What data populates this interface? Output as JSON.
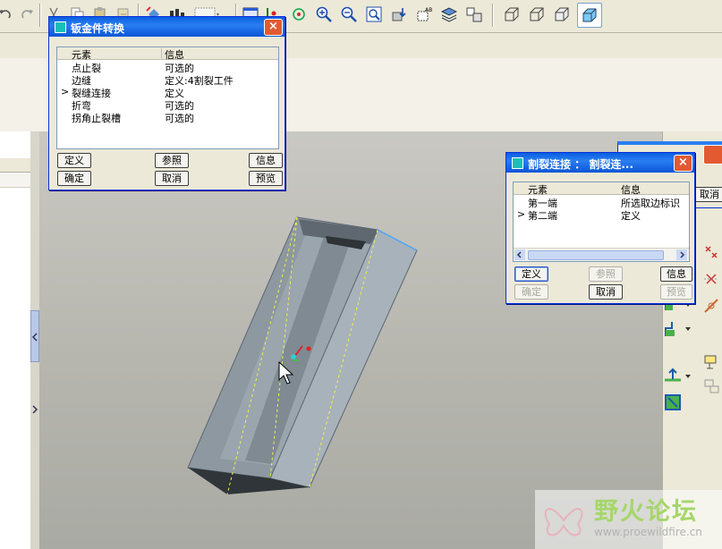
{
  "toolbar": {
    "icons": [
      "undo-icon",
      "redo-icon",
      "cut-icon",
      "copy-icon",
      "paste-icon",
      "paste-special-icon",
      "regenerate-icon",
      "dimension-icon",
      "sketch-box-icon",
      "repaint-icon",
      "spin-center-icon",
      "orient-icon",
      "zoom-in-icon",
      "zoom-out-icon",
      "refit-icon",
      "saved-view-icon",
      "layers-icon",
      "view-manager-icon",
      "wireframe-icon",
      "hidden-line-icon",
      "no-hidden-icon",
      "shading-icon"
    ]
  },
  "dialog_sheetmetal": {
    "title": "钣金件转换",
    "close_label": "×",
    "columns": [
      "元素",
      "信息"
    ],
    "rows": [
      {
        "marker": "",
        "element": "点止裂",
        "info": "可选的"
      },
      {
        "marker": "",
        "element": "边缝",
        "info": "定义:4割裂工件"
      },
      {
        "marker": ">",
        "element": "裂缝连接",
        "info": "定义"
      },
      {
        "marker": "",
        "element": "折弯",
        "info": "可选的"
      },
      {
        "marker": "",
        "element": "拐角止裂槽",
        "info": "可选的"
      }
    ],
    "buttons": {
      "define": "定义",
      "reference": "参照",
      "info": "信息",
      "ok": "确定",
      "cancel": "取消",
      "preview": "预览"
    }
  },
  "dialog_rip": {
    "title": "割裂连接 ： 割裂连...",
    "close_label": "×",
    "columns": [
      "元素",
      "信息"
    ],
    "rows": [
      {
        "marker": "",
        "element": "第一端",
        "info": "所选取边标识"
      },
      {
        "marker": ">",
        "element": "第二端",
        "info": "定义"
      }
    ],
    "buttons": {
      "define": "定义",
      "reference": "参照",
      "info": "信息",
      "ok": "确定",
      "cancel": "取消",
      "preview": "预览"
    }
  },
  "behind_dialog": {
    "partial_button": "取消"
  },
  "watermark": {
    "name": "野火论坛",
    "url": "www.proewildfire.cn"
  },
  "colors": {
    "title_bar": "#0a5fe0",
    "model_face": "#8f9aa3",
    "edge_highlight": "#f2f24a"
  }
}
